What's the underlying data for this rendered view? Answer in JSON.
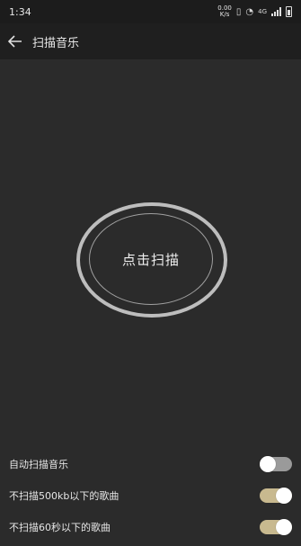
{
  "status_bar": {
    "time": "1:34",
    "net_speed_value": "0.00",
    "net_speed_unit": "K/s",
    "network_type": "4G"
  },
  "header": {
    "title": "扫描音乐"
  },
  "scan": {
    "button_label": "点击扫描"
  },
  "settings": [
    {
      "label": "自动扫描音乐",
      "enabled": false
    },
    {
      "label": "不扫描500kb以下的歌曲",
      "enabled": true
    },
    {
      "label": "不扫描60秒以下的歌曲",
      "enabled": true
    }
  ],
  "colors": {
    "background": "#2b2b2b",
    "toolbar": "#1f1f1f",
    "toggle_on": "#c8b98f",
    "toggle_off": "#9a9a9a"
  }
}
